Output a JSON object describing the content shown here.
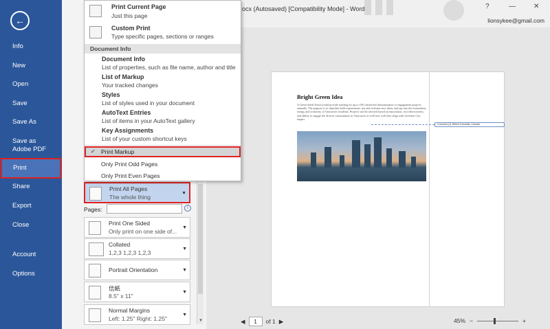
{
  "window": {
    "title": "ocx (Autosaved) [Compatibility Mode] - Word",
    "help": "?",
    "minimize": "—",
    "close": "✕",
    "user_email": "lionsykee@gmail.com"
  },
  "sidebar": {
    "back": "←",
    "items": [
      {
        "label": "Info"
      },
      {
        "label": "New"
      },
      {
        "label": "Open"
      },
      {
        "label": "Save"
      },
      {
        "label": "Save As"
      },
      {
        "label": "Save as Adobe PDF"
      },
      {
        "label": "Print"
      },
      {
        "label": "Share"
      },
      {
        "label": "Export"
      },
      {
        "label": "Close"
      },
      {
        "label": "Account"
      },
      {
        "label": "Options"
      }
    ],
    "active": "Print"
  },
  "dropdown": {
    "top_items": [
      {
        "title": "Print Current Page",
        "desc": "Just this page"
      },
      {
        "title": "Custom Print",
        "desc": "Type specific pages, sections or ranges"
      }
    ],
    "section_header": "Document Info",
    "info_items": [
      {
        "title": "Document Info",
        "desc": "List of properties, such as file name, author and title"
      },
      {
        "title": "List of Markup",
        "desc": "Your tracked changes"
      },
      {
        "title": "Styles",
        "desc": "List of styles used in your document"
      },
      {
        "title": "AutoText Entries",
        "desc": "List of items in your AutoText gallery"
      },
      {
        "title": "Key Assignments",
        "desc": "List of your custom shortcut keys"
      }
    ],
    "check_item": {
      "mark": "✓",
      "label": "Print Markup"
    },
    "plain_items": [
      {
        "label": "Only Print Odd Pages"
      },
      {
        "label": "Only Print Even Pages"
      }
    ]
  },
  "settings": {
    "print_range": {
      "title": "Print All Pages",
      "desc": "The whole thing"
    },
    "pages_label": "Pages:",
    "pages_value": "",
    "info": "i",
    "sided": {
      "title": "Print One Sided",
      "desc": "Only print on one side of..."
    },
    "collate": {
      "title": "Collated",
      "desc": "1,2,3    1,2,3    1,2,3"
    },
    "orientation": {
      "title": "Portrait Orientation",
      "desc": ""
    },
    "paper": {
      "title": "信紙",
      "desc": "8.5\" x 11\""
    },
    "margins": {
      "title": "Normal Margins",
      "desc": "Left:  1.25\"    Right:  1.25\""
    },
    "arrow": "▼",
    "scroll_down": "▼"
  },
  "preview": {
    "heading": "Bright Green Idea",
    "body": "A Green Seeds Fund would provide funding for up to 100 citizen-led demonstration or engagement projects annually. The purpose is to stimulate bold experiments, test and evaluate new ideas, and tap into the tremendous energy and creativity of Vancouver residents. Projects will be selected based on innovation, cost effectiveness, and ability to engage the diverse communities in Vancouver as well new well they align with Greenest City targets.",
    "comment": "Comment [1]: British Columbia, Canada"
  },
  "navigation": {
    "prev": "◀",
    "page": "1",
    "of": "of 1",
    "next": "▶"
  },
  "zoom": {
    "value": "45%",
    "minus": "−",
    "plus": "+"
  }
}
